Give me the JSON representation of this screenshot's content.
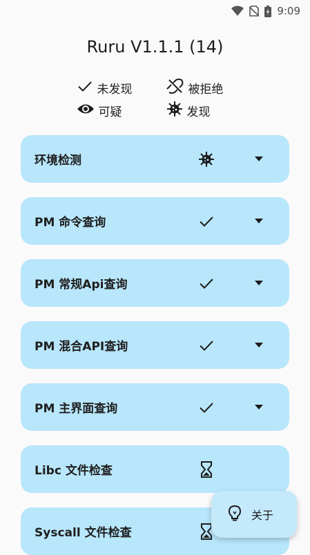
{
  "status_bar": {
    "time": "9:09"
  },
  "app": {
    "title": "Ruru V1.1.1 (14)"
  },
  "legend": {
    "not_found": "未发现",
    "denied": "被拒绝",
    "suspicious": "可疑",
    "found": "发现"
  },
  "cards": [
    {
      "label": "环境检测",
      "status_icon": "virus-icon",
      "expandable": true
    },
    {
      "label": "PM 命令查询",
      "status_icon": "check-icon",
      "expandable": true
    },
    {
      "label": "PM 常规Api查询",
      "status_icon": "check-icon",
      "expandable": true
    },
    {
      "label": "PM 混合API查询",
      "status_icon": "check-icon",
      "expandable": true
    },
    {
      "label": "PM 主界面查询",
      "status_icon": "check-icon",
      "expandable": true
    },
    {
      "label": "Libc 文件检查",
      "status_icon": "hourglass-icon",
      "expandable": false
    },
    {
      "label": "Syscall 文件检查",
      "status_icon": "hourglass-icon",
      "expandable": false
    }
  ],
  "fab": {
    "label": "关于",
    "icon": "lightbulb-icon"
  },
  "colors": {
    "card_bg": "#b8e6fb",
    "background": "#fbfafa",
    "fab_bg": "#c4e9fa"
  }
}
